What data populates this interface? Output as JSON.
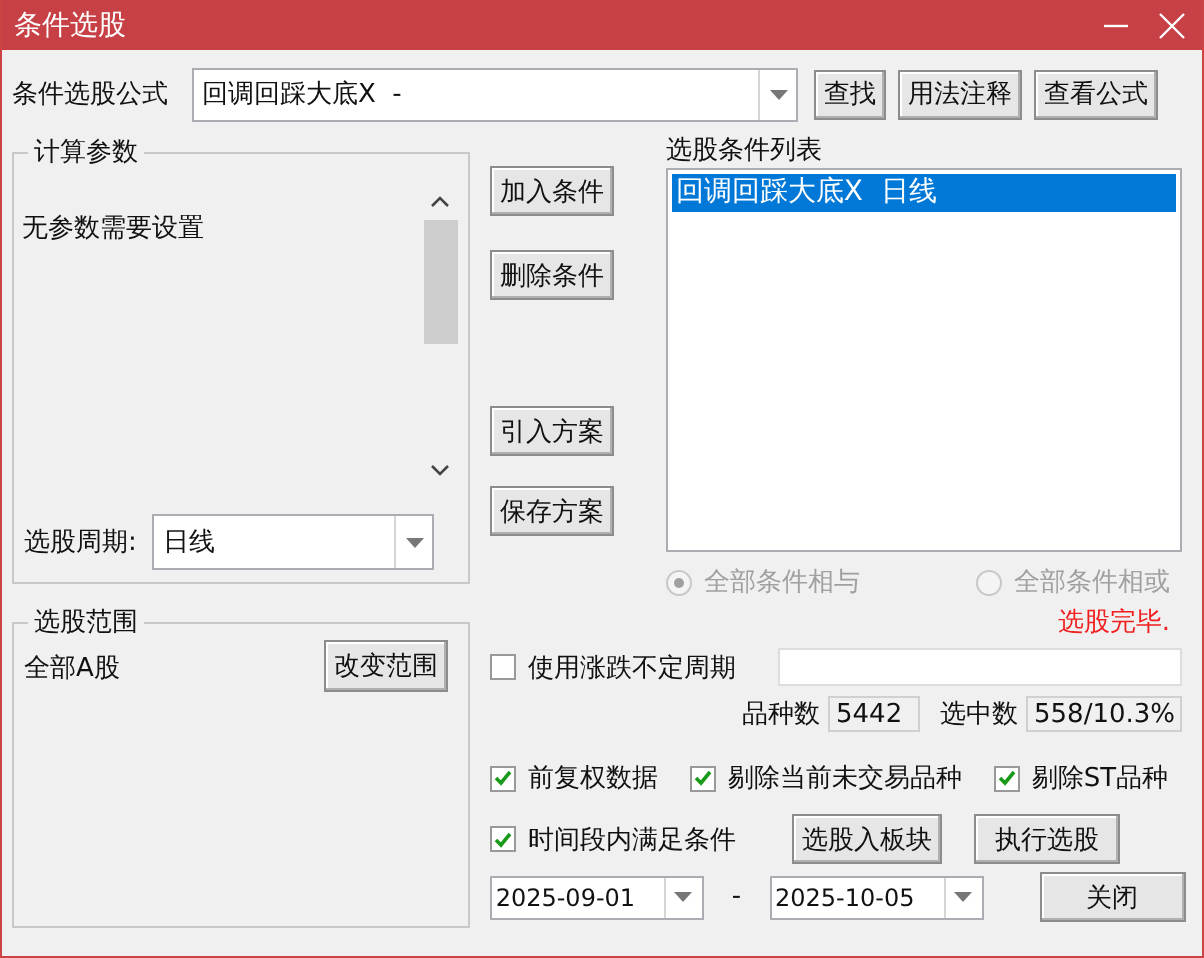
{
  "window": {
    "title": "条件选股"
  },
  "formula": {
    "label": "条件选股公式",
    "value": "回调回踩大底X  -"
  },
  "formula_buttons": [
    "查找",
    "用法注释",
    "查看公式"
  ],
  "params": {
    "title": "计算参数",
    "text": "无参数需要设置",
    "period_label": "选股周期:",
    "period_value": "日线"
  },
  "scope": {
    "title": "选股范围",
    "value": "全部A股",
    "button": "改变范围"
  },
  "actions": [
    "加入条件",
    "删除条件",
    "引入方案",
    "保存方案"
  ],
  "conditions": {
    "title": "选股条件列表",
    "items": [
      {
        "label": "回调回踩大底X  日线",
        "selected": true
      }
    ]
  },
  "logic": [
    {
      "label": "全部条件相与",
      "selected": true,
      "disabled": true
    },
    {
      "label": "全部条件相或",
      "selected": false,
      "disabled": true
    }
  ],
  "status": "选股完毕.",
  "variable_period": {
    "label": "使用涨跌不定周期",
    "checked": false
  },
  "counts": [
    {
      "label": "品种数",
      "value": "5442"
    },
    {
      "label": "选中数",
      "value": "558/10.3%"
    }
  ],
  "options": [
    {
      "label": "前复权数据",
      "checked": true
    },
    {
      "label": "剔除当前未交易品种",
      "checked": true
    },
    {
      "label": "剔除ST品种",
      "checked": true
    }
  ],
  "time_range": {
    "label": "时间段内满足条件",
    "checked": true,
    "from": "2025-09-01",
    "separator": "-",
    "to": "2025-10-05"
  },
  "buttons": [
    "选股入板块",
    "执行选股",
    "关闭"
  ]
}
